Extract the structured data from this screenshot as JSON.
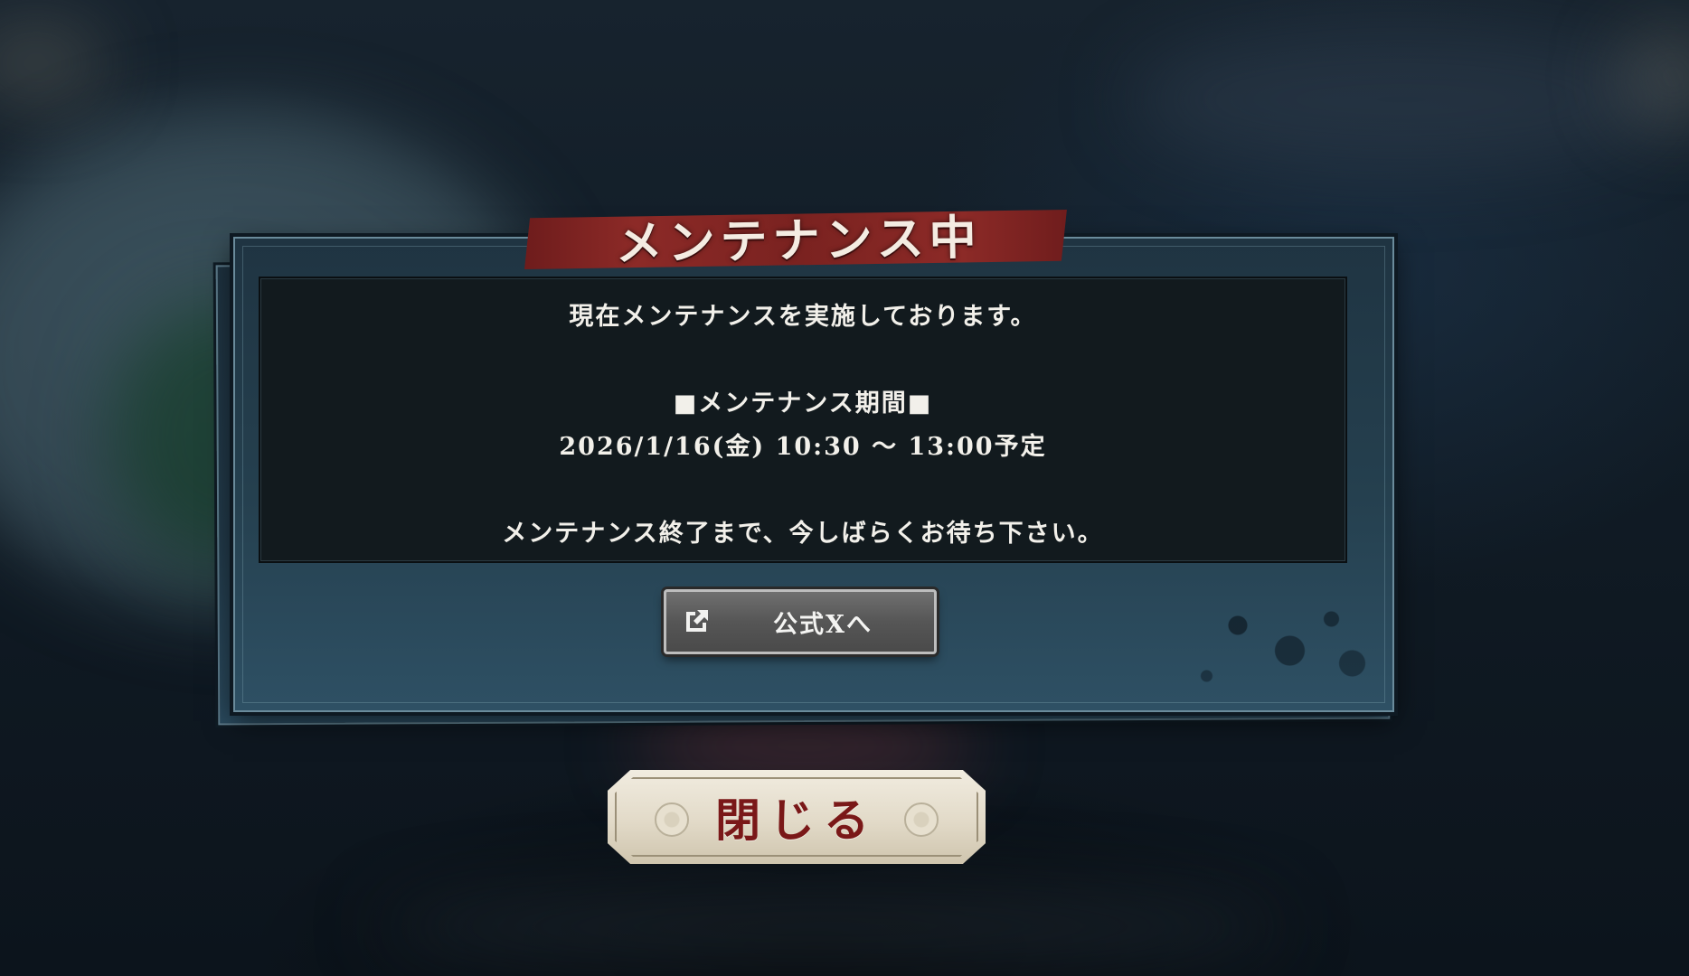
{
  "dialog": {
    "title": "メンテナンス中",
    "message": {
      "line1": "現在メンテナンスを実施しております。",
      "period_heading": "■メンテナンス期間■",
      "period_value": "2026/1/16(金) 10:30 ～ 13:00予定",
      "line_end": "メンテナンス終了まで、今しばらくお待ち下さい。"
    },
    "official_x_button": {
      "label": "公式Xへ",
      "icon": "external-link-icon"
    }
  },
  "close_button": {
    "label": "閉じる"
  },
  "colors": {
    "title_banner": "#8c2a27",
    "panel": "#25404f",
    "message_box": "#121a1e",
    "close_label": "#7a1818",
    "close_plate": "#e2dac8"
  }
}
